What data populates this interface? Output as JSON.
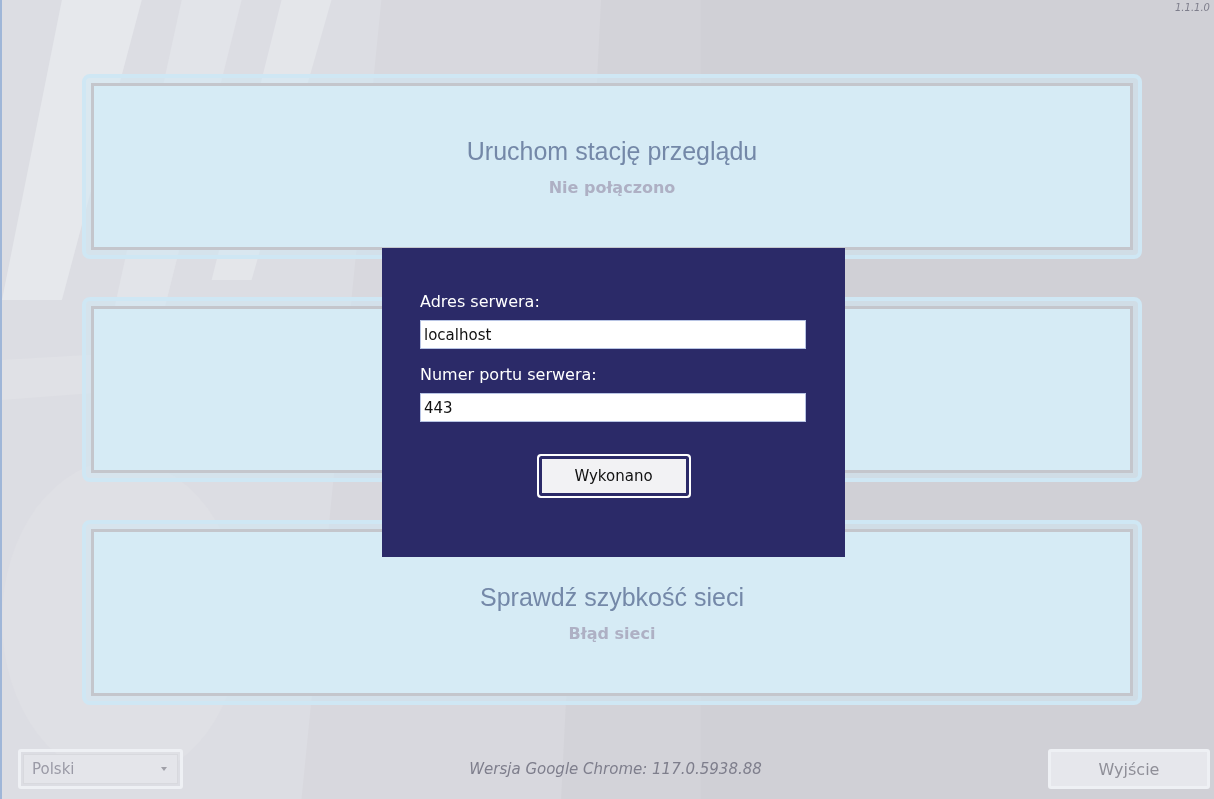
{
  "version": "1.1.1.0",
  "cards": [
    {
      "title": "Uruchom stację przeglądu",
      "status": "Nie połączono"
    },
    {
      "title": "Sprawdź szybkość sieci",
      "status": "Błąd sieci"
    }
  ],
  "dialog": {
    "fields": [
      {
        "label": "Adres serwera:",
        "value": "localhost"
      },
      {
        "label": "Numer portu serwera:",
        "value": "443"
      }
    ],
    "button": "Wykonano"
  },
  "footer": {
    "language": "Polski",
    "browser_version": "Wersja Google Chrome:  117.0.5938.88",
    "exit_button": "Wyjście"
  }
}
